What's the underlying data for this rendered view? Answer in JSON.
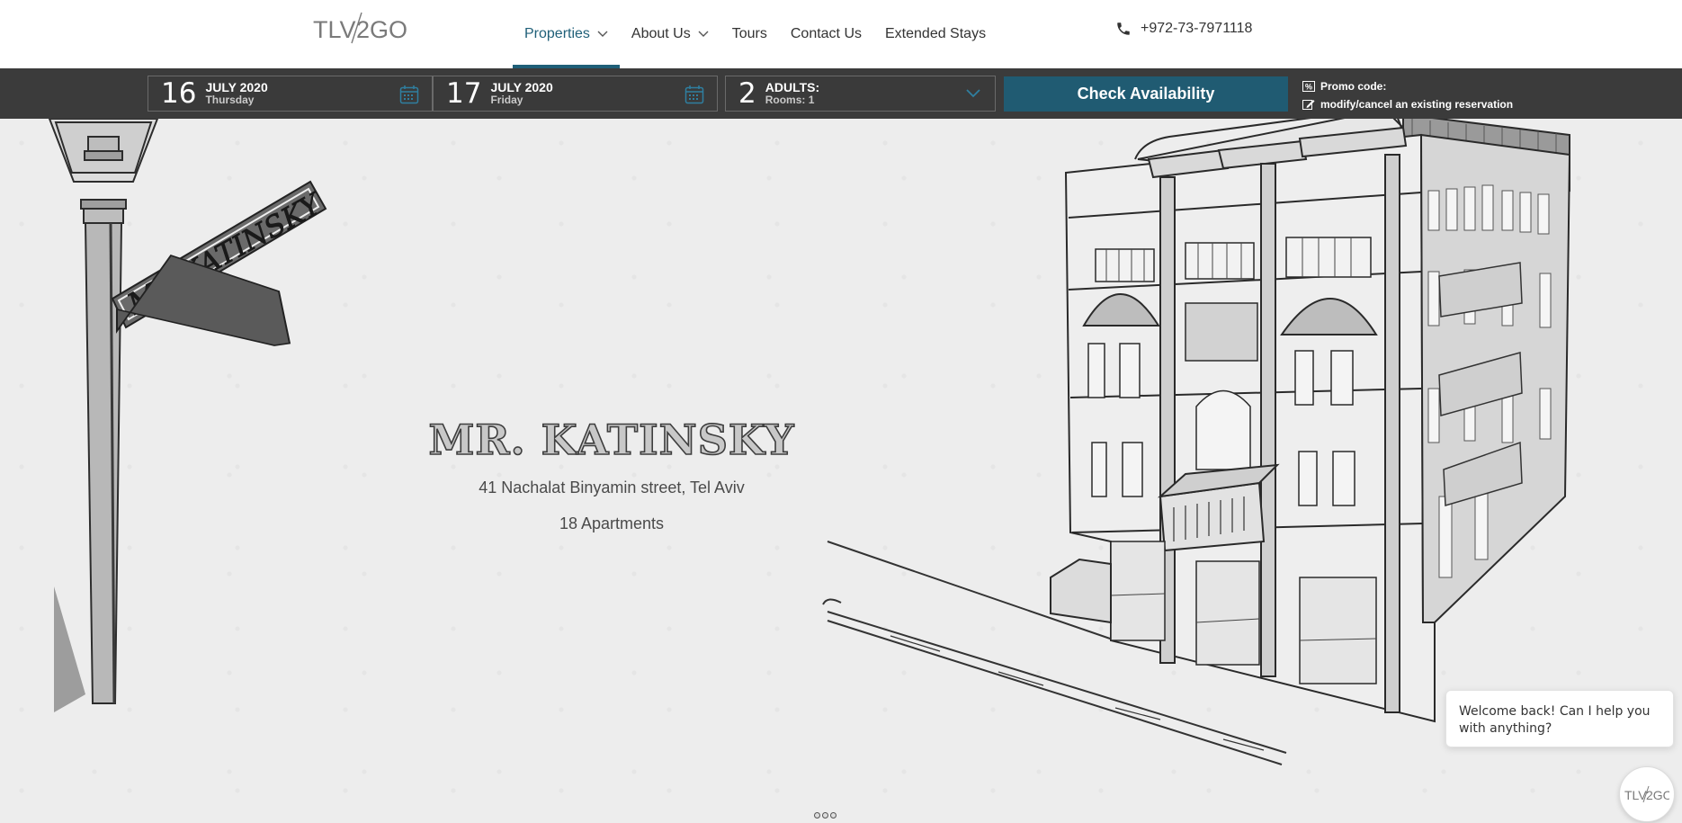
{
  "brand": {
    "logo_text_left": "TLV",
    "logo_text_right": "2GO"
  },
  "nav": {
    "items": [
      {
        "label": "Properties",
        "has_dropdown": true,
        "active": true
      },
      {
        "label": "About Us",
        "has_dropdown": true,
        "active": false
      },
      {
        "label": "Tours",
        "has_dropdown": false,
        "active": false
      },
      {
        "label": "Contact Us",
        "has_dropdown": false,
        "active": false
      },
      {
        "label": "Extended Stays",
        "has_dropdown": false,
        "active": false
      }
    ],
    "phone": "+972-73-7971118"
  },
  "booking": {
    "checkin": {
      "day": "16",
      "month_year": "JULY 2020",
      "weekday": "Thursday"
    },
    "checkout": {
      "day": "17",
      "month_year": "JULY 2020",
      "weekday": "Friday"
    },
    "guests": {
      "count": "2",
      "label": "ADULTS:",
      "rooms": "Rooms: 1"
    },
    "check_button": "Check Availability",
    "promo_label": "Promo code:",
    "modify_label": "modify/cancel an existing reservation"
  },
  "hero": {
    "title": "MR. KATINSKY",
    "address": "41 Nachalat Binyamin street, Tel Aviv",
    "apartments": "18 Apartments",
    "sign_text": "MR KATINSKY"
  },
  "chat": {
    "message": "Welcome back! Can I help you with anything?"
  },
  "colors": {
    "accent": "#1f5f78",
    "button": "#205b72",
    "bar": "#3b3b3b"
  },
  "icons": {
    "phone": "phone-icon",
    "calendar": "calendar-icon",
    "chevron": "chevron-down-icon",
    "promo": "percent-icon",
    "edit": "edit-icon"
  }
}
